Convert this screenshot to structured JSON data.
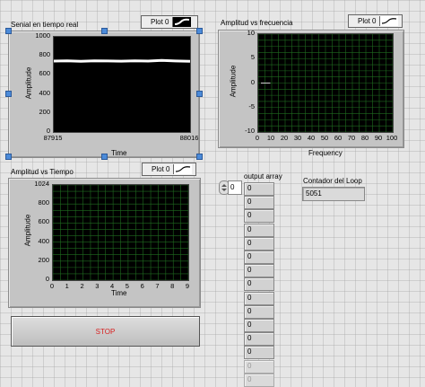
{
  "chart_data": [
    {
      "type": "line",
      "title": "Senial en tiempo real",
      "xlabel": "Time",
      "ylabel": "Amplitude",
      "xlim": [
        87915,
        88016
      ],
      "ylim": [
        0,
        1000
      ],
      "y_ticks": [
        "1000",
        "800",
        "600",
        "400",
        "200",
        "0"
      ],
      "x_ticks": [
        "87915",
        "88016"
      ],
      "grid": false,
      "legend": "top-right",
      "series": [
        {
          "name": "Plot 0",
          "color": "#ffffff",
          "x": [
            87915,
            87925,
            87935,
            87945,
            87955,
            87965,
            87975,
            87985,
            87995,
            88005,
            88016
          ],
          "values": [
            745,
            748,
            743,
            747,
            746,
            744,
            747,
            745,
            752,
            746,
            742
          ]
        }
      ]
    },
    {
      "type": "line",
      "title": "Amplitud vs  frecuencia",
      "xlabel": "Frequency",
      "ylabel": "Amplitude",
      "xlim": [
        0,
        100
      ],
      "ylim": [
        -10,
        10
      ],
      "y_ticks": [
        "10",
        "5",
        "0",
        "-5",
        "-10"
      ],
      "x_ticks": [
        "0",
        "10",
        "20",
        "30",
        "40",
        "50",
        "60",
        "70",
        "80",
        "90",
        "100"
      ],
      "grid": true,
      "legend": "top-right",
      "series": [
        {
          "name": "Plot 0",
          "color": "#d0d0d0",
          "x": [
            2,
            9
          ],
          "values": [
            0,
            0
          ]
        }
      ]
    },
    {
      "type": "line",
      "title": "Amplitud vs Tiempo",
      "xlabel": "Time",
      "ylabel": "Amplitude",
      "xlim": [
        0,
        9
      ],
      "ylim": [
        0,
        1024
      ],
      "y_ticks": [
        "1024",
        "800",
        "600",
        "400",
        "200",
        "0"
      ],
      "x_ticks": [
        "0",
        "1",
        "2",
        "3",
        "4",
        "5",
        "6",
        "7",
        "8",
        "9"
      ],
      "grid": true,
      "legend": "top-right",
      "series": []
    }
  ],
  "output_array": {
    "label": "output array",
    "index": "0",
    "values": [
      "0",
      "0",
      "0",
      "0",
      "0",
      "0",
      "0",
      "0",
      "0",
      "0",
      "0",
      "0",
      "0",
      "0",
      "0"
    ]
  },
  "loop_counter": {
    "label": "Contador del Loop",
    "value": "5051"
  },
  "stop_button": {
    "label": "STOP"
  },
  "colors": {
    "plot_bg": "#000000",
    "grid": "#1f6b1f",
    "panel": "#c4c4c4",
    "stop_text": "#d82020"
  }
}
